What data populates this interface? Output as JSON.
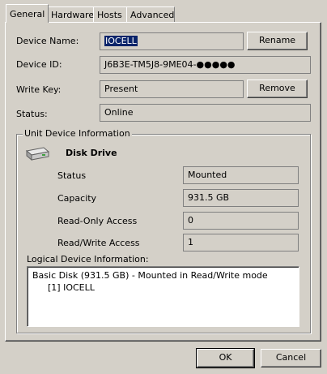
{
  "tabs": [
    {
      "label": "General",
      "active": true
    },
    {
      "label": "Hardware",
      "active": false
    },
    {
      "label": "Hosts",
      "active": false
    },
    {
      "label": "Advanced",
      "active": false
    }
  ],
  "general": {
    "device_name_label": "Device Name:",
    "device_name_value": "IOCELL",
    "rename_button": "Rename",
    "device_id_label": "Device ID:",
    "device_id_value": "J6B3E-TM5J8-9ME04-●●●●●",
    "write_key_label": "Write Key:",
    "write_key_value": "Present",
    "remove_button": "Remove",
    "status_label": "Status:",
    "status_value": "Online"
  },
  "unit_info": {
    "group_title": "Unit Device Information",
    "device_icon": "disk-drive-icon",
    "device_type": "Disk Drive",
    "rows": [
      {
        "label": "Status",
        "value": "Mounted"
      },
      {
        "label": "Capacity",
        "value": "931.5 GB"
      },
      {
        "label": "Read-Only Access",
        "value": "0"
      },
      {
        "label": "Read/Write Access",
        "value": "1"
      }
    ],
    "logical_label": "Logical Device Information:",
    "logical_items": [
      "Basic Disk (931.5 GB) - Mounted in Read/Write mode",
      "[1] IOCELL"
    ]
  },
  "footer": {
    "ok_button": "OK",
    "cancel_button": "Cancel"
  },
  "colors": {
    "window_bg": "#d4d0c8",
    "selection": "#0a246a"
  }
}
